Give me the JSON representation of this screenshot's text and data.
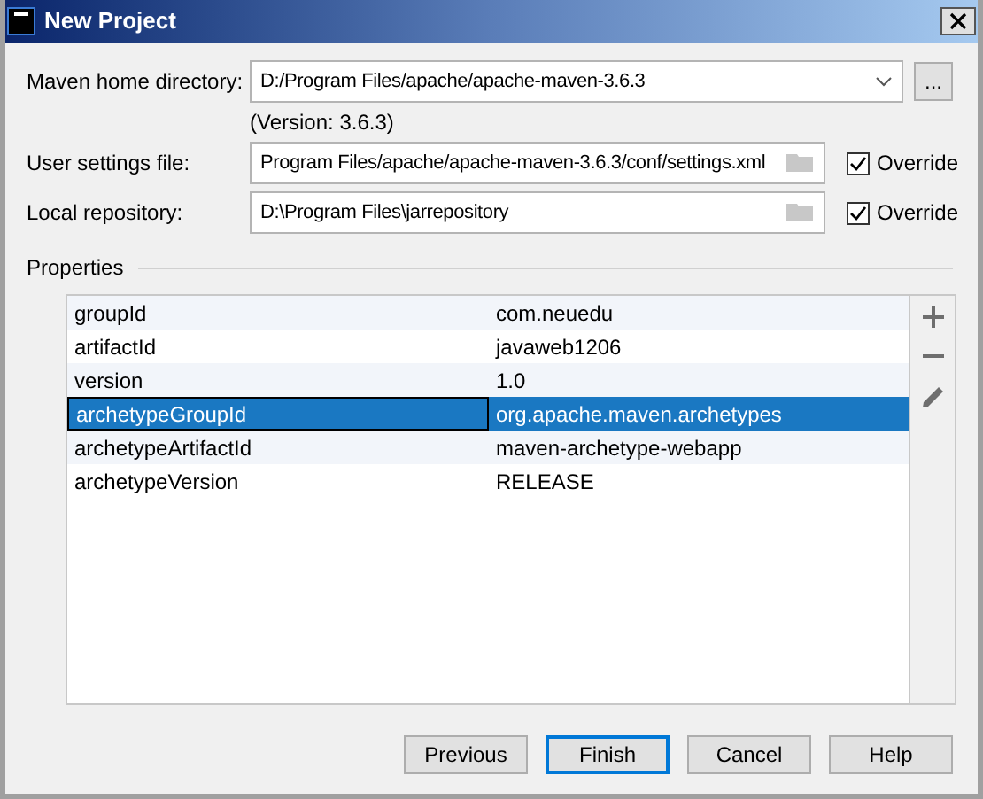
{
  "window": {
    "title": "New Project"
  },
  "fields": [
    {
      "kind": "combo",
      "label": "Maven home directory:",
      "value": "D:/Program Files/apache/apache-maven-3.6.3",
      "button": "...",
      "note": "(Version: 3.6.3)"
    },
    {
      "kind": "path",
      "label": "User settings file:",
      "value": "Program Files/apache/apache-maven-3.6.3/conf/settings.xml",
      "override": {
        "label": "Override",
        "checked": true
      }
    },
    {
      "kind": "path",
      "label": "Local repository:",
      "value": "D:\\Program Files\\jarrepository",
      "override": {
        "label": "Override",
        "checked": true
      }
    }
  ],
  "properties": {
    "title": "Properties",
    "rows": [
      {
        "key": "groupId",
        "value": "com.neuedu",
        "selected": false
      },
      {
        "key": "artifactId",
        "value": "javaweb1206",
        "selected": false
      },
      {
        "key": "version",
        "value": "1.0",
        "selected": false
      },
      {
        "key": "archetypeGroupId",
        "value": "org.apache.maven.archetypes",
        "selected": true
      },
      {
        "key": "archetypeArtifactId",
        "value": "maven-archetype-webapp",
        "selected": false
      },
      {
        "key": "archetypeVersion",
        "value": "RELEASE",
        "selected": false
      }
    ]
  },
  "buttons": [
    {
      "label": "Previous",
      "default": false
    },
    {
      "label": "Finish",
      "default": true
    },
    {
      "label": "Cancel",
      "default": false
    },
    {
      "label": "Help",
      "default": false
    }
  ]
}
